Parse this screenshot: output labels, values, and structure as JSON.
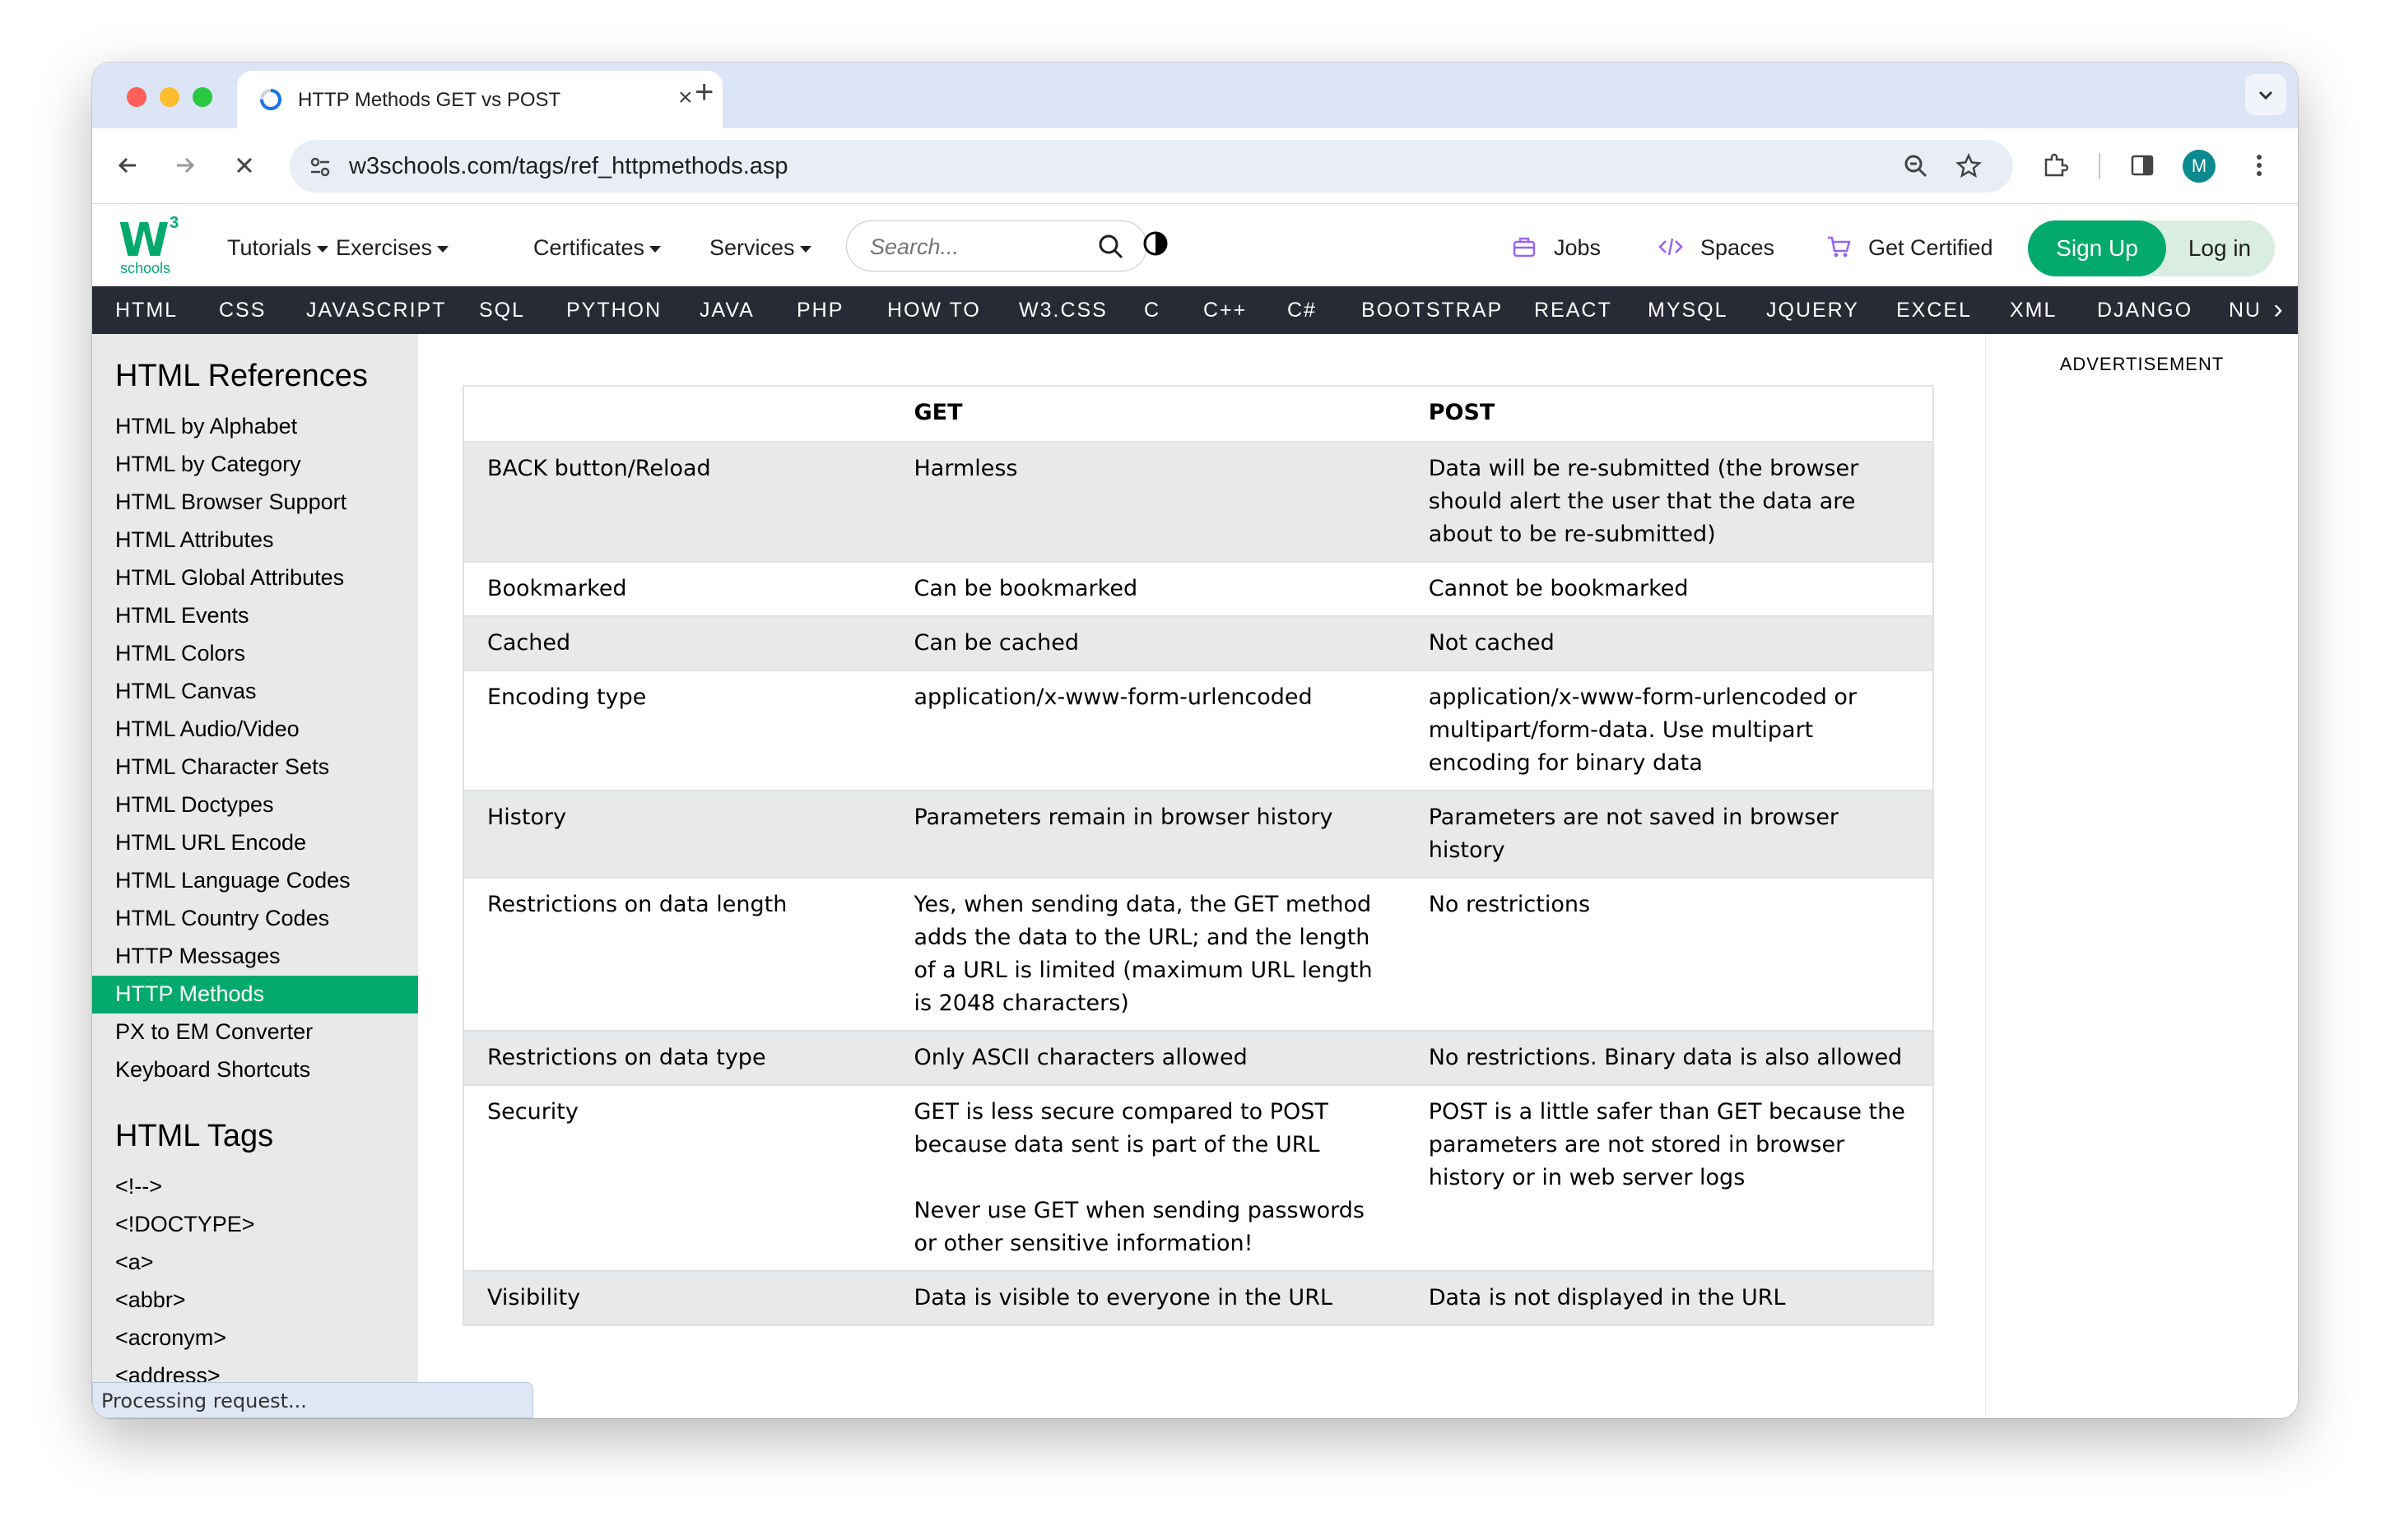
{
  "browser": {
    "tab_title": "HTTP Methods GET vs POST",
    "url": "w3schools.com/tags/ref_httpmethods.asp",
    "profile_initial": "M"
  },
  "header": {
    "logo_mark": "W",
    "logo_sup": "3",
    "logo_text": "schools",
    "menus": [
      "Tutorials",
      "Exercises",
      "Certificates",
      "Services"
    ],
    "search_placeholder": "Search...",
    "links": {
      "jobs": "Jobs",
      "spaces": "Spaces",
      "certified": "Get Certified"
    },
    "signup": "Sign Up",
    "login": "Log in",
    "accent_color": "#04aa6d"
  },
  "topnav": [
    "HTML",
    "CSS",
    "JAVASCRIPT",
    "SQL",
    "PYTHON",
    "JAVA",
    "PHP",
    "HOW TO",
    "W3.CSS",
    "C",
    "C++",
    "C#",
    "BOOTSTRAP",
    "REACT",
    "MYSQL",
    "JQUERY",
    "EXCEL",
    "XML",
    "DJANGO",
    "NU"
  ],
  "sidebar": {
    "references_heading": "HTML References",
    "references": [
      "HTML by Alphabet",
      "HTML by Category",
      "HTML Browser Support",
      "HTML Attributes",
      "HTML Global Attributes",
      "HTML Events",
      "HTML Colors",
      "HTML Canvas",
      "HTML Audio/Video",
      "HTML Character Sets",
      "HTML Doctypes",
      "HTML URL Encode",
      "HTML Language Codes",
      "HTML Country Codes",
      "HTTP Messages",
      "HTTP Methods",
      "PX to EM Converter",
      "Keyboard Shortcuts"
    ],
    "active_item": "HTTP Methods",
    "tags_heading": "HTML Tags",
    "tags": [
      "<!-->",
      "<!DOCTYPE>",
      "<a>",
      "<abbr>",
      "<acronym>",
      "<address>"
    ]
  },
  "table": {
    "headers": [
      "",
      "GET",
      "POST"
    ],
    "rows": [
      [
        "BACK button/Reload",
        "Harmless",
        "Data will be re-submitted (the browser should alert the user that the data are about to be re-submitted)"
      ],
      [
        "Bookmarked",
        "Can be bookmarked",
        "Cannot be bookmarked"
      ],
      [
        "Cached",
        "Can be cached",
        "Not cached"
      ],
      [
        "Encoding type",
        "application/x-www-form-urlencoded",
        "application/x-www-form-urlencoded or multipart/form-data. Use multipart encoding for binary data"
      ],
      [
        "History",
        "Parameters remain in browser history",
        "Parameters are not saved in browser history"
      ],
      [
        "Restrictions on data length",
        "Yes, when sending data, the GET method adds the data to the URL; and the length of a URL is limited (maximum URL length is 2048 characters)",
        "No restrictions"
      ],
      [
        "Restrictions on data type",
        "Only ASCII characters allowed",
        "No restrictions. Binary data is also allowed"
      ],
      [
        "Security",
        "GET is less secure compared to POST because data sent is part of the URL\n\nNever use GET when sending passwords or other sensitive information!",
        "POST is a little safer than GET because the parameters are not stored in browser history or in web server logs"
      ],
      [
        "Visibility",
        "Data is visible to everyone in the URL",
        "Data is not displayed in the URL"
      ]
    ]
  },
  "advertisement_label": "ADVERTISEMENT",
  "status_text": "Processing request..."
}
